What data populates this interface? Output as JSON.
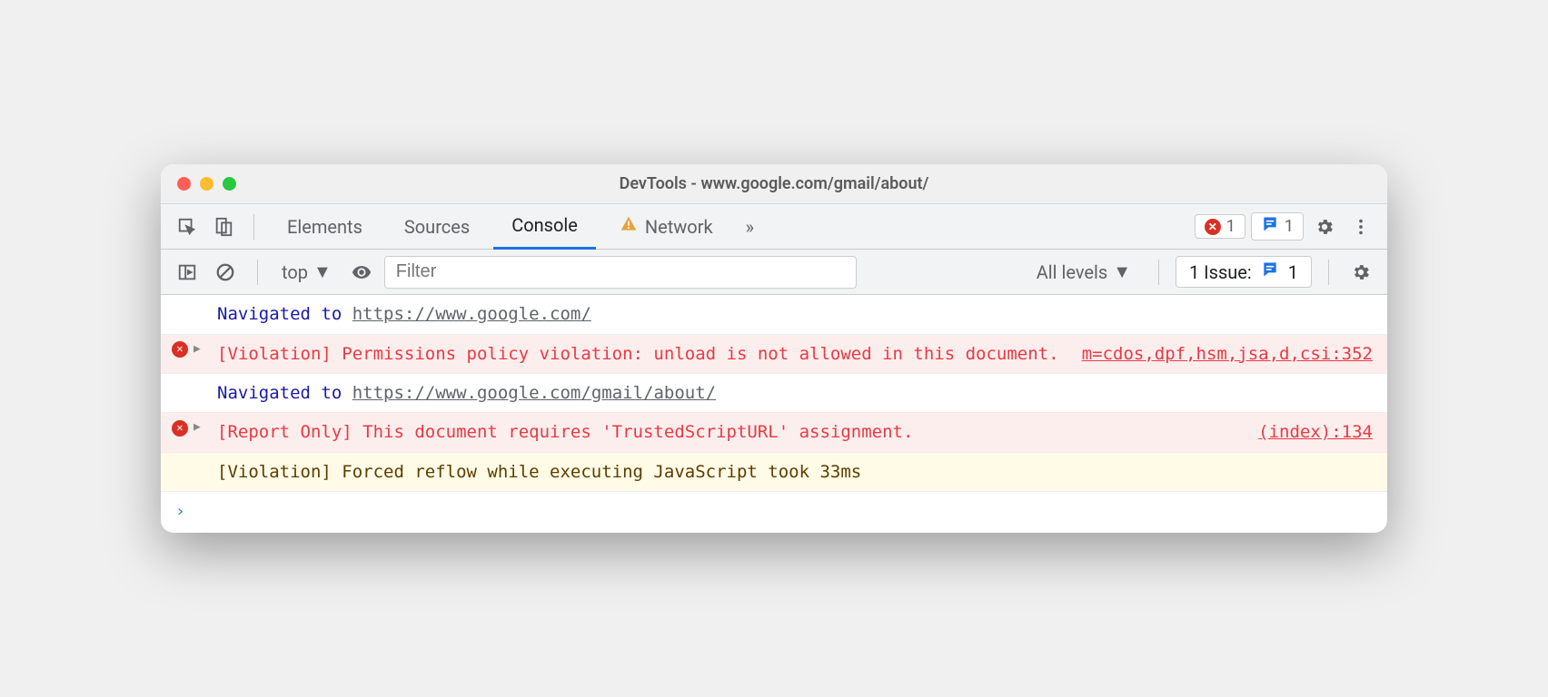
{
  "window": {
    "title": "DevTools - www.google.com/gmail/about/"
  },
  "tabs": {
    "elements": "Elements",
    "sources": "Sources",
    "console": "Console",
    "network": "Network",
    "more": "»"
  },
  "counters": {
    "errors": "1",
    "messages": "1"
  },
  "toolbar": {
    "context": "top",
    "filter_placeholder": "Filter",
    "levels": "All levels",
    "issues_label": "1 Issue:",
    "issues_count": "1"
  },
  "log": {
    "nav1_prefix": "Navigated to ",
    "nav1_url": "https://www.google.com/",
    "err1_text": "[Violation] Permissions policy violation: unload is not allowed in this document.",
    "err1_src": "m=cdos,dpf,hsm,jsa,d,csi:352",
    "nav2_prefix": "Navigated to ",
    "nav2_url": "https://www.google.com/gmail/about/",
    "err2_text": "[Report Only] This document requires 'TrustedScriptURL' assignment.",
    "err2_src": "(index):134",
    "warn1_text": "[Violation] Forced reflow while executing JavaScript took 33ms"
  },
  "prompt": "›"
}
